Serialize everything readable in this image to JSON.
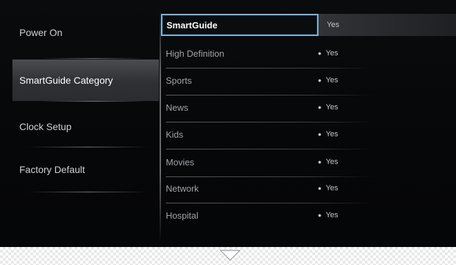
{
  "menu": {
    "items": [
      {
        "label": "Power On"
      },
      {
        "label": "SmartGuide Category"
      },
      {
        "label": "Clock Setup"
      },
      {
        "label": "Factory Default"
      }
    ]
  },
  "list": {
    "items": [
      {
        "label": "SmartGuide",
        "value": "Yes"
      },
      {
        "label": "High Definition",
        "value": "Yes"
      },
      {
        "label": "Sports",
        "value": "Yes"
      },
      {
        "label": "News",
        "value": "Yes"
      },
      {
        "label": "Kids",
        "value": "Yes"
      },
      {
        "label": "Movies",
        "value": "Yes"
      },
      {
        "label": "Network",
        "value": "Yes"
      },
      {
        "label": "Hospital",
        "value": "Yes"
      }
    ]
  },
  "icons": {
    "bullet": "bullet-icon",
    "scroll_down": "chevron-down-icon"
  },
  "colors": {
    "highlight_border": "#7fb6e0",
    "screen_bg": "#060708"
  }
}
